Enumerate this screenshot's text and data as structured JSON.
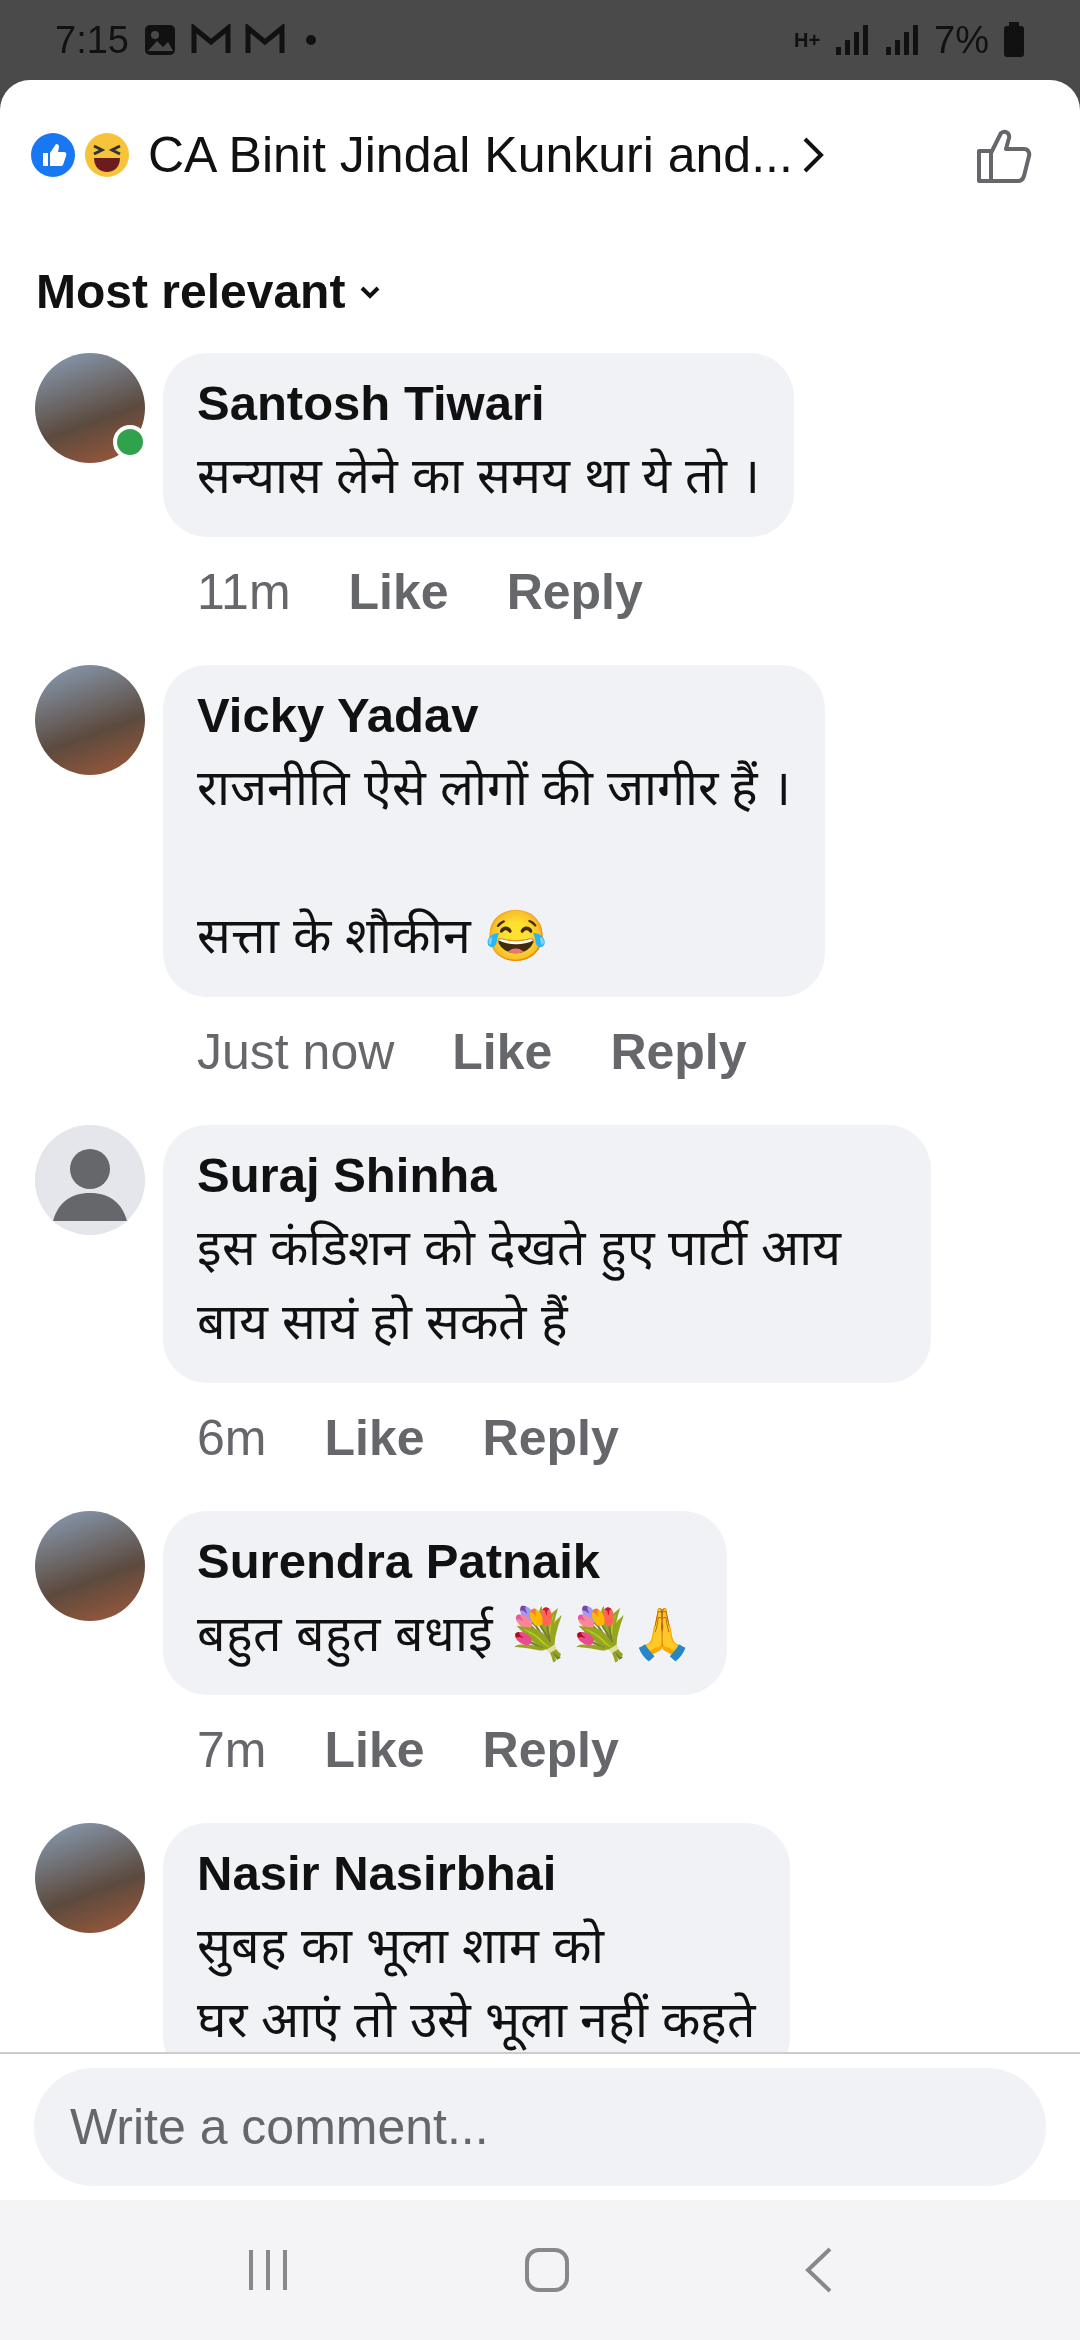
{
  "status_bar": {
    "time": "7:15",
    "network": "H+",
    "battery": "7%"
  },
  "header": {
    "title": "CA Binit Jindal Kunkuri and..."
  },
  "sort": {
    "label": "Most relevant"
  },
  "comments": [
    {
      "author": "Santosh Tiwari",
      "kind": "photo",
      "online": true,
      "text": "सन्यास लेने का समय था ये तो ।",
      "time": "11m",
      "like": "Like",
      "reply": "Reply"
    },
    {
      "author": "Vicky Yadav",
      "kind": "photo",
      "online": false,
      "text": "राजनीति ऐसे लोगों की जागीर हैं ।\n\nसत्ता के शौकीन 😂",
      "time": "Just now",
      "like": "Like",
      "reply": "Reply"
    },
    {
      "author": "Suraj Shinha",
      "kind": "default",
      "online": false,
      "text": "इस कंडिशन को देखते हुए पार्टी आय बाय सायं हो सकते हैं",
      "time": "6m",
      "like": "Like",
      "reply": "Reply"
    },
    {
      "author": "Surendra Patnaik",
      "kind": "photo",
      "online": false,
      "text": "बहुत बहुत बधाई 💐💐🙏",
      "time": "7m",
      "like": "Like",
      "reply": "Reply"
    },
    {
      "author": "Nasir Nasirbhai",
      "kind": "photo",
      "online": false,
      "text": "सुबह का भूला शाम को\nघर आएं तो उसे भूला नहीं कहते"
    }
  ],
  "composer": {
    "placeholder": "Write a comment..."
  }
}
